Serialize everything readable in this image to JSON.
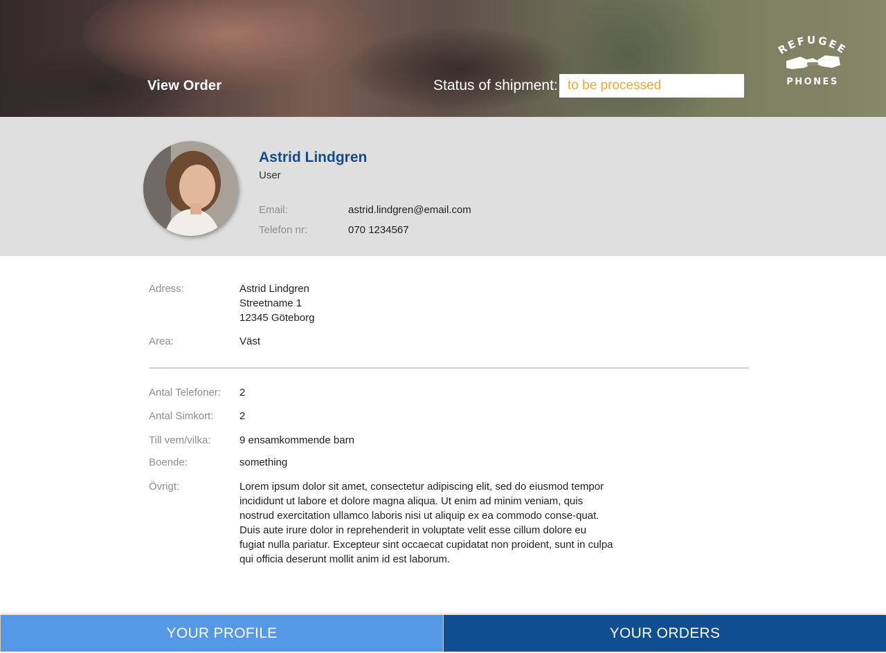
{
  "header": {
    "title": "View Order",
    "status_label": "Status of shipment:",
    "status_value": "to be processed",
    "logo_text_top": "REFUGEE",
    "logo_text_bottom": "PHONES"
  },
  "profile": {
    "name": "Astrid Lindgren",
    "role": "User",
    "email_label": "Email:",
    "email": "astrid.lindgren@email.com",
    "phone_label": "Telefon nr:",
    "phone": "070 1234567"
  },
  "address": {
    "label": "Adress:",
    "line1": "Astrid Lindgren",
    "line2": "Streetname 1",
    "line3": "12345 Göteborg",
    "area_label": "Area:",
    "area": "Väst"
  },
  "order": {
    "phones_label": "Antal Telefoner:",
    "phones": "2",
    "sims_label": "Antal Simkort:",
    "sims": "2",
    "recipient_label": "Till vem/vilka:",
    "recipient": "9 ensamkommende barn",
    "housing_label": "Boende:",
    "housing": "something",
    "other_label": "Övrigt:",
    "other": "Lorem ipsum dolor sit amet, consectetur adipiscing elit, sed do eiusmod tempor incididunt ut labore et dolore magna aliqua. Ut enim ad minim veniam, quis nostrud exercitation ullamco laboris nisi ut aliquip ex ea commodo conse-quat. Duis aute irure dolor in reprehenderit in voluptate velit esse cillum dolore eu fugiat nulla pariatur. Excepteur sint occaecat cupidatat non proident, sunt in culpa qui officia deserunt mollit anim id est laborum."
  },
  "nav": {
    "profile": "YOUR PROFILE",
    "orders": "YOUR ORDERS"
  },
  "colors": {
    "accent_blue": "#124c8a",
    "status_orange": "#f0a92e",
    "nav_light": "#5599e6",
    "nav_dark": "#0f4e91"
  }
}
